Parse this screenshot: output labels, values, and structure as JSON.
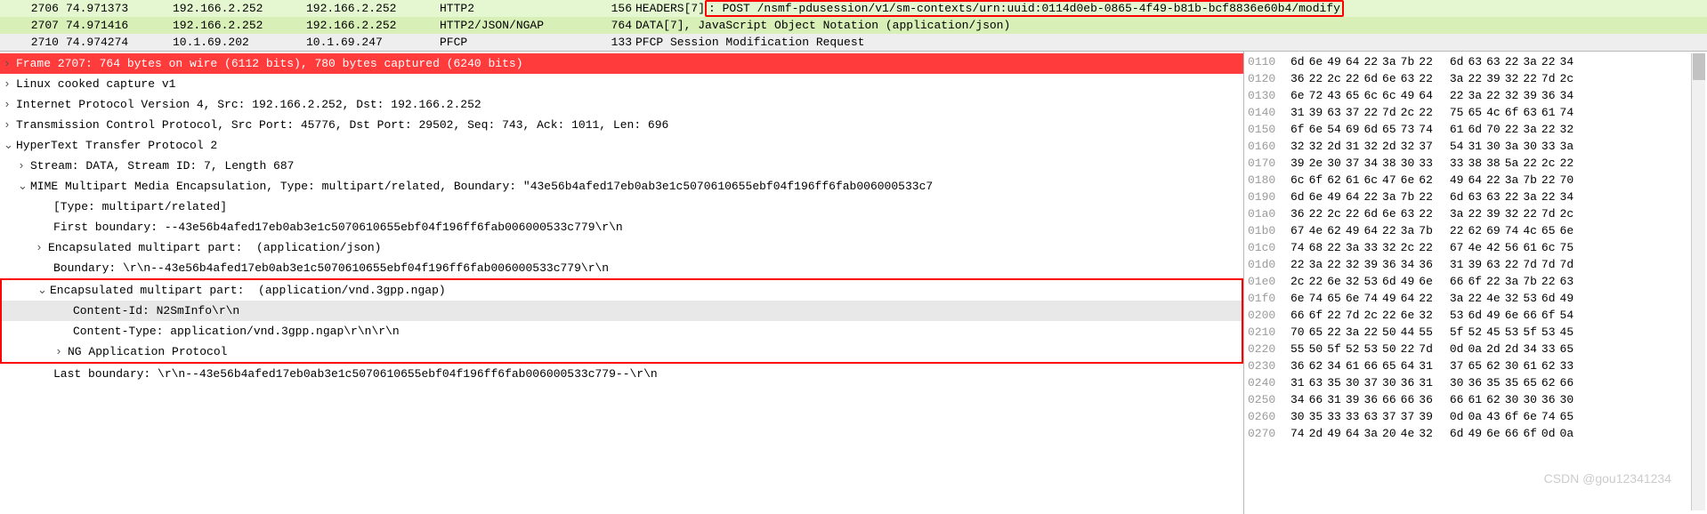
{
  "packet_list": [
    {
      "no": "2706",
      "time": "74.971373",
      "src": "192.166.2.252",
      "dst": "192.166.2.252",
      "proto": "HTTP2",
      "len": "156",
      "info_pre": "HEADERS[7]",
      "info_hl": ": POST /nsmf-pdusession/v1/sm-contexts/urn:uuid:0114d0eb-0865-4f49-b81b-bcf8836e60b4/modify",
      "info_post": "",
      "cls": "sel1"
    },
    {
      "no": "2707",
      "time": "74.971416",
      "src": "192.166.2.252",
      "dst": "192.166.2.252",
      "proto": "HTTP2/JSON/NGAP",
      "len": "764",
      "info": "DATA[7], JavaScript Object Notation (application/json)",
      "cls": "sel2"
    },
    {
      "no": "2710",
      "time": "74.974274",
      "src": "10.1.69.202",
      "dst": "10.1.69.247",
      "proto": "PFCP",
      "len": "133",
      "info": "PFCP Session Modification Request",
      "cls": "sel3"
    }
  ],
  "tree": {
    "frame": "Frame 2707: 764 bytes on wire (6112 bits), 780 bytes captured (6240 bits)",
    "linux": "Linux cooked capture v1",
    "ip": "Internet Protocol Version 4, Src: 192.166.2.252, Dst: 192.166.2.252",
    "tcp": "Transmission Control Protocol, Src Port: 45776, Dst Port: 29502, Seq: 743, Ack: 1011, Len: 696",
    "http2": "HyperText Transfer Protocol 2",
    "stream": "Stream: DATA, Stream ID: 7, Length 687",
    "mime": "MIME Multipart Media Encapsulation, Type: multipart/related, Boundary: \"43e56b4afed17eb0ab3e1c5070610655ebf04f196ff6fab006000533c7",
    "type": "[Type: multipart/related]",
    "first": "First boundary: --43e56b4afed17eb0ab3e1c5070610655ebf04f196ff6fab006000533c779\\r\\n",
    "enc1": "Encapsulated multipart part:  (application/json)",
    "bound1": "Boundary: \\r\\n--43e56b4afed17eb0ab3e1c5070610655ebf04f196ff6fab006000533c779\\r\\n",
    "enc2": "Encapsulated multipart part:  (application/vnd.3gpp.ngap)",
    "cid": "Content-Id: N2SmInfo\\r\\n",
    "ctype": "Content-Type: application/vnd.3gpp.ngap\\r\\n\\r\\n",
    "ngap": "NG Application Protocol",
    "last": "Last boundary: \\r\\n--43e56b4afed17eb0ab3e1c5070610655ebf04f196ff6fab006000533c779--\\r\\n"
  },
  "hex": [
    {
      "o": "0110",
      "b": [
        "6d",
        "6e",
        "49",
        "64",
        "22",
        "3a",
        "7b",
        "22",
        "",
        "6d",
        "63",
        "63",
        "22",
        "3a",
        "22",
        "34",
        ""
      ]
    },
    {
      "o": "0120",
      "b": [
        "36",
        "22",
        "2c",
        "22",
        "6d",
        "6e",
        "63",
        "22",
        "",
        "3a",
        "22",
        "39",
        "32",
        "22",
        "7d",
        "2c",
        ""
      ]
    },
    {
      "o": "0130",
      "b": [
        "6e",
        "72",
        "43",
        "65",
        "6c",
        "6c",
        "49",
        "64",
        "",
        "22",
        "3a",
        "22",
        "32",
        "39",
        "36",
        "34",
        ""
      ]
    },
    {
      "o": "0140",
      "b": [
        "31",
        "39",
        "63",
        "37",
        "22",
        "7d",
        "2c",
        "22",
        "",
        "75",
        "65",
        "4c",
        "6f",
        "63",
        "61",
        "74",
        ""
      ]
    },
    {
      "o": "0150",
      "b": [
        "6f",
        "6e",
        "54",
        "69",
        "6d",
        "65",
        "73",
        "74",
        "",
        "61",
        "6d",
        "70",
        "22",
        "3a",
        "22",
        "32",
        ""
      ]
    },
    {
      "o": "0160",
      "b": [
        "32",
        "32",
        "2d",
        "31",
        "32",
        "2d",
        "32",
        "37",
        "",
        "54",
        "31",
        "30",
        "3a",
        "30",
        "33",
        "3a",
        ""
      ]
    },
    {
      "o": "0170",
      "b": [
        "39",
        "2e",
        "30",
        "37",
        "34",
        "38",
        "30",
        "33",
        "",
        "33",
        "38",
        "38",
        "5a",
        "22",
        "2c",
        "22",
        ""
      ]
    },
    {
      "o": "0180",
      "b": [
        "6c",
        "6f",
        "62",
        "61",
        "6c",
        "47",
        "6e",
        "62",
        "",
        "49",
        "64",
        "22",
        "3a",
        "7b",
        "22",
        "70",
        ""
      ]
    },
    {
      "o": "0190",
      "b": [
        "6d",
        "6e",
        "49",
        "64",
        "22",
        "3a",
        "7b",
        "22",
        "",
        "6d",
        "63",
        "63",
        "22",
        "3a",
        "22",
        "34",
        ""
      ]
    },
    {
      "o": "01a0",
      "b": [
        "36",
        "22",
        "2c",
        "22",
        "6d",
        "6e",
        "63",
        "22",
        "",
        "3a",
        "22",
        "39",
        "32",
        "22",
        "7d",
        "2c",
        ""
      ]
    },
    {
      "o": "01b0",
      "b": [
        "67",
        "4e",
        "62",
        "49",
        "64",
        "22",
        "3a",
        "7b",
        "",
        "22",
        "62",
        "69",
        "74",
        "4c",
        "65",
        "6e",
        ""
      ]
    },
    {
      "o": "01c0",
      "b": [
        "74",
        "68",
        "22",
        "3a",
        "33",
        "32",
        "2c",
        "22",
        "",
        "67",
        "4e",
        "42",
        "56",
        "61",
        "6c",
        "75",
        ""
      ]
    },
    {
      "o": "01d0",
      "b": [
        "22",
        "3a",
        "22",
        "32",
        "39",
        "36",
        "34",
        "36",
        "",
        "31",
        "39",
        "63",
        "22",
        "7d",
        "7d",
        "7d",
        ""
      ]
    },
    {
      "o": "01e0",
      "b": [
        "2c",
        "22",
        "6e",
        "32",
        "53",
        "6d",
        "49",
        "6e",
        "",
        "66",
        "6f",
        "22",
        "3a",
        "7b",
        "22",
        "63",
        ""
      ]
    },
    {
      "o": "01f0",
      "b": [
        "6e",
        "74",
        "65",
        "6e",
        "74",
        "49",
        "64",
        "22",
        "",
        "3a",
        "22",
        "4e",
        "32",
        "53",
        "6d",
        "49",
        ""
      ]
    },
    {
      "o": "0200",
      "b": [
        "66",
        "6f",
        "22",
        "7d",
        "2c",
        "22",
        "6e",
        "32",
        "",
        "53",
        "6d",
        "49",
        "6e",
        "66",
        "6f",
        "54",
        ""
      ]
    },
    {
      "o": "0210",
      "b": [
        "70",
        "65",
        "22",
        "3a",
        "22",
        "50",
        "44",
        "55",
        "",
        "5f",
        "52",
        "45",
        "53",
        "5f",
        "53",
        "45",
        ""
      ]
    },
    {
      "o": "0220",
      "b": [
        "55",
        "50",
        "5f",
        "52",
        "53",
        "50",
        "22",
        "7d",
        "",
        "0d",
        "0a",
        "2d",
        "2d",
        "34",
        "33",
        "65",
        ""
      ]
    },
    {
      "o": "0230",
      "b": [
        "36",
        "62",
        "34",
        "61",
        "66",
        "65",
        "64",
        "31",
        "",
        "37",
        "65",
        "62",
        "30",
        "61",
        "62",
        "33",
        ""
      ]
    },
    {
      "o": "0240",
      "b": [
        "31",
        "63",
        "35",
        "30",
        "37",
        "30",
        "36",
        "31",
        "",
        "30",
        "36",
        "35",
        "35",
        "65",
        "62",
        "66",
        ""
      ]
    },
    {
      "o": "0250",
      "b": [
        "34",
        "66",
        "31",
        "39",
        "36",
        "66",
        "66",
        "36",
        "",
        "66",
        "61",
        "62",
        "30",
        "30",
        "36",
        "30",
        ""
      ]
    },
    {
      "o": "0260",
      "b": [
        "30",
        "35",
        "33",
        "33",
        "63",
        "37",
        "37",
        "39",
        "",
        "0d",
        "0a",
        "43",
        "6f",
        "6e",
        "74",
        "65",
        ""
      ]
    },
    {
      "o": "0270",
      "b": [
        "74",
        "2d",
        "49",
        "64",
        "3a",
        "20",
        "4e",
        "32",
        "",
        "6d",
        "49",
        "6e",
        "66",
        "6f",
        "0d",
        "0a",
        ""
      ]
    }
  ],
  "watermark": "CSDN @gou12341234"
}
